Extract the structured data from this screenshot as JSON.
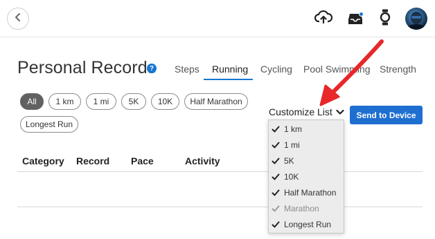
{
  "header": {
    "back_icon": "chevron-left-icon",
    "icons": [
      "cloud-upload-icon",
      "inbox-icon",
      "watch-icon"
    ],
    "notification_color": "#1976d2"
  },
  "page": {
    "title": "Personal Records",
    "help_glyph": "?"
  },
  "tabs": [
    {
      "label": "Steps",
      "active": false
    },
    {
      "label": "Running",
      "active": true
    },
    {
      "label": "Cycling",
      "active": false
    },
    {
      "label": "Pool Swimming",
      "active": false
    },
    {
      "label": "Strength",
      "active": false
    }
  ],
  "filters": [
    {
      "label": "All",
      "active": true
    },
    {
      "label": "1 km",
      "active": false
    },
    {
      "label": "1 mi",
      "active": false
    },
    {
      "label": "5K",
      "active": false
    },
    {
      "label": "10K",
      "active": false
    },
    {
      "label": "Half Marathon",
      "active": false
    },
    {
      "label": "Longest Run",
      "active": false
    }
  ],
  "customize_list": {
    "label": "Customize List",
    "items": [
      {
        "label": "1 km",
        "checked": true,
        "enabled": true
      },
      {
        "label": "1 mi",
        "checked": true,
        "enabled": true
      },
      {
        "label": "5K",
        "checked": true,
        "enabled": true
      },
      {
        "label": "10K",
        "checked": true,
        "enabled": true
      },
      {
        "label": "Half Marathon",
        "checked": true,
        "enabled": true
      },
      {
        "label": "Marathon",
        "checked": true,
        "enabled": false
      },
      {
        "label": "Longest Run",
        "checked": true,
        "enabled": true
      }
    ]
  },
  "send_button": "Send to Device",
  "table": {
    "columns": [
      "Category",
      "Record",
      "Pace",
      "Activity"
    ]
  },
  "colors": {
    "accent": "#1f6fd1",
    "annotation": "#e8272a"
  }
}
